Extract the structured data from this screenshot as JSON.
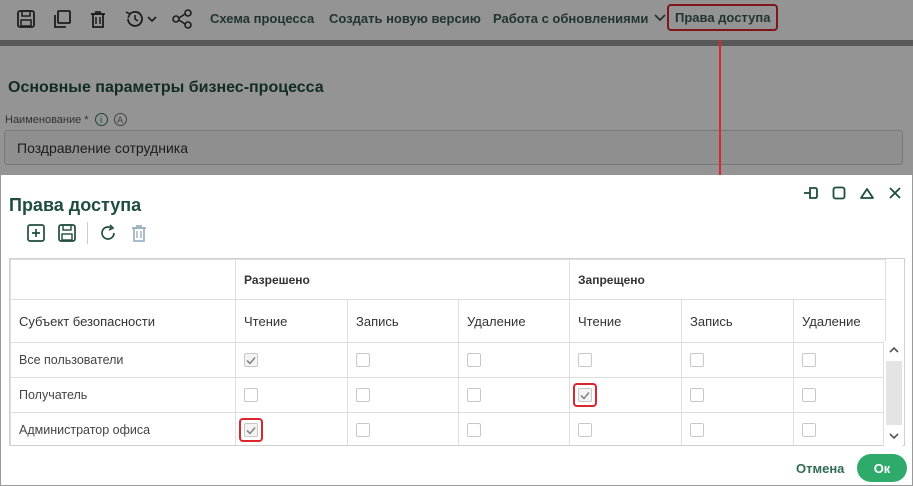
{
  "toolbar": {
    "icons": [
      "save-icon",
      "copy-icon",
      "trash-icon",
      "history-icon",
      "share-icon"
    ],
    "process_scheme": "Схема процесса",
    "new_version": "Создать новую версию",
    "updates": "Работа с обновлениями",
    "access_rights": "Права доступа"
  },
  "page": {
    "section_title": "Основные параметры бизнес-процесса",
    "name_label": "Наименование *",
    "info_badge": "i",
    "a_badge": "A",
    "name_value": "Поздравление сотрудника"
  },
  "modal": {
    "title": "Права доступа",
    "window_icons": [
      "pin-icon",
      "maximize-icon",
      "collapse-icon",
      "close-icon"
    ],
    "tool_icons": [
      "add-icon",
      "save-icon",
      "refresh-icon",
      "delete-icon"
    ],
    "table": {
      "group_allowed": "Разрешено",
      "group_denied": "Запрещено",
      "subject_header": "Субъект безопасности",
      "sub_headers": [
        "Чтение",
        "Запись",
        "Удаление",
        "Чтение",
        "Запись",
        "Удаление"
      ],
      "rows": [
        {
          "subject": "Все пользователи",
          "values": [
            true,
            false,
            false,
            false,
            false,
            false
          ]
        },
        {
          "subject": "Получатель",
          "values": [
            false,
            false,
            false,
            true,
            false,
            false
          ]
        },
        {
          "subject": "Администратор офиса",
          "values": [
            true,
            false,
            false,
            false,
            false,
            false
          ]
        }
      ]
    },
    "cancel": "Отмена",
    "ok": "Ок"
  },
  "colors": {
    "accent_green": "#2eaa6a",
    "title_green": "#1f4d3f",
    "highlight_red": "#d9262f"
  }
}
